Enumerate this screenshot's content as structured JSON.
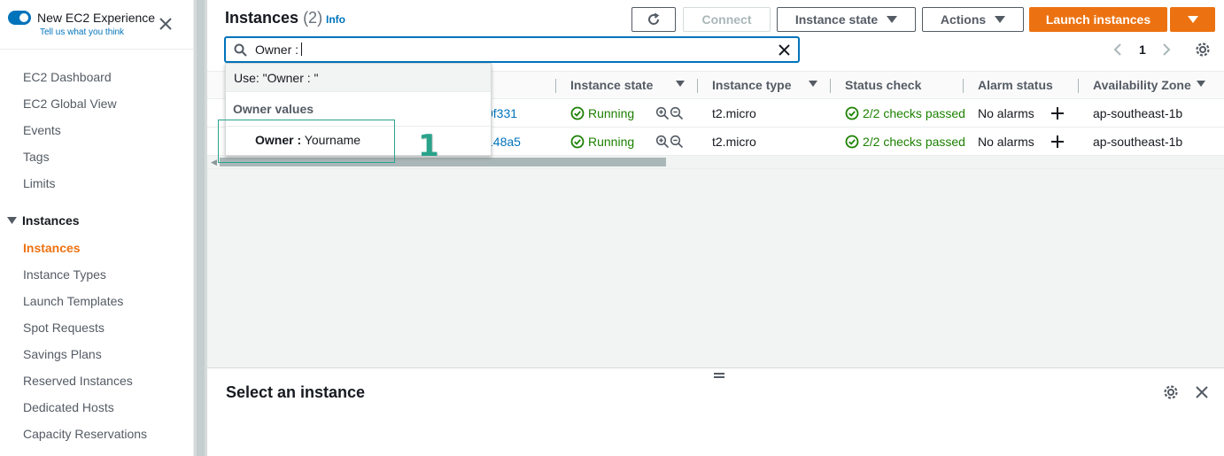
{
  "sidebar": {
    "experience_title": "New EC2 Experience",
    "experience_subtitle": "Tell us what you think",
    "items": [
      {
        "label": "EC2 Dashboard"
      },
      {
        "label": "EC2 Global View"
      },
      {
        "label": "Events"
      },
      {
        "label": "Tags"
      },
      {
        "label": "Limits"
      }
    ],
    "section_title": "Instances",
    "section_items": [
      {
        "label": "Instances",
        "active": true
      },
      {
        "label": "Instance Types"
      },
      {
        "label": "Launch Templates"
      },
      {
        "label": "Spot Requests"
      },
      {
        "label": "Savings Plans"
      },
      {
        "label": "Reserved Instances"
      },
      {
        "label": "Dedicated Hosts"
      },
      {
        "label": "Capacity Reservations"
      }
    ]
  },
  "header": {
    "title": "Instances",
    "count": "(2)",
    "info": "Info"
  },
  "toolbar": {
    "connect": "Connect",
    "instance_state": "Instance state",
    "actions": "Actions",
    "launch": "Launch instances"
  },
  "search": {
    "value": "Owner :"
  },
  "pagination": {
    "page": "1"
  },
  "table": {
    "columns": [
      "Instance state",
      "Instance type",
      "Status check",
      "Alarm status",
      "Availability Zone"
    ],
    "rows": [
      {
        "id_suffix": "0f331",
        "state": "Running",
        "type": "t2.micro",
        "status": "2/2 checks passed",
        "alarm": "No alarms",
        "zone": "ap-southeast-1b"
      },
      {
        "id_suffix": "148a5",
        "state": "Running",
        "type": "t2.micro",
        "status": "2/2 checks passed",
        "alarm": "No alarms",
        "zone": "ap-southeast-1b"
      }
    ]
  },
  "dropdown": {
    "use_text": "Use: \"Owner : \"",
    "group_label": "Owner values",
    "option_key": "Owner :",
    "option_value": "Yourname"
  },
  "annotation": {
    "number": "1"
  },
  "details": {
    "title": "Select an instance"
  },
  "colors": {
    "accent": "#ec7211",
    "link": "#0073bb",
    "success": "#1d8102",
    "annotation": "#2aa38b"
  }
}
